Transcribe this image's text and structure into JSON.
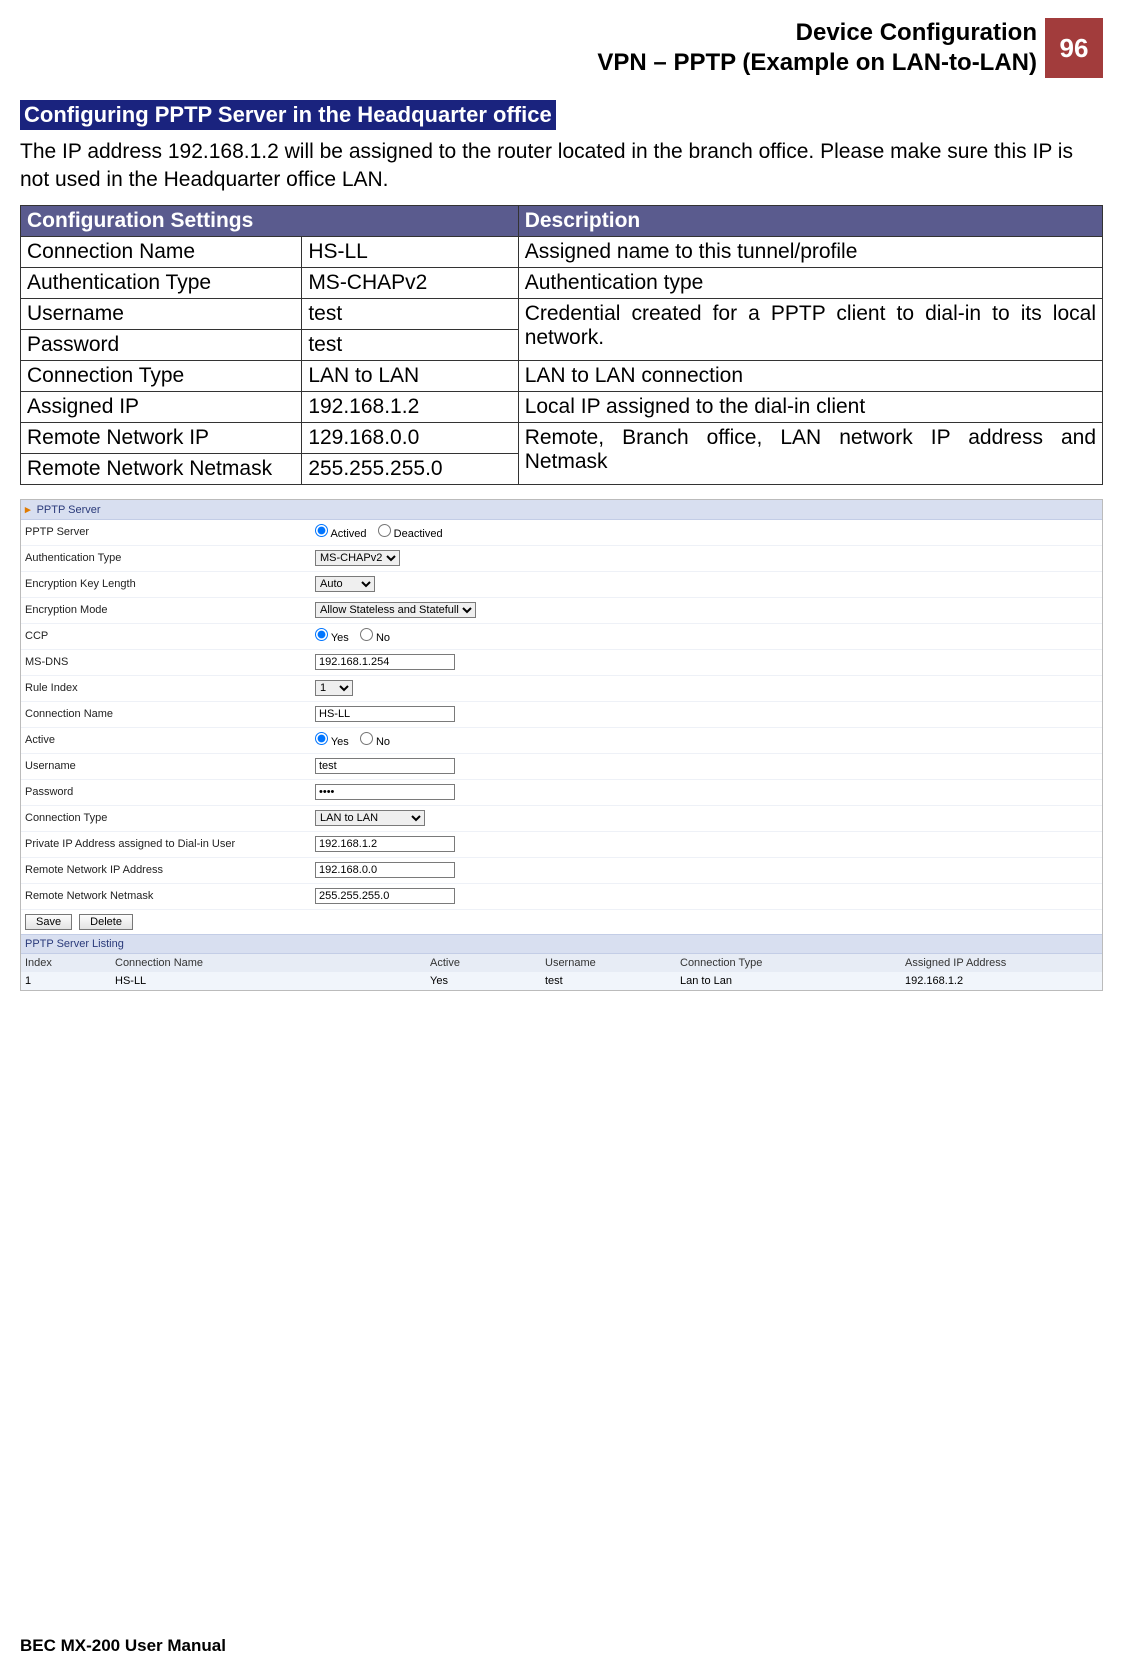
{
  "header": {
    "line1": "Device Configuration",
    "line2": "VPN – PPTP (Example on LAN-to-LAN)",
    "page_number": "96"
  },
  "section": {
    "title": "Configuring PPTP Server in the Headquarter office",
    "paragraph": "The IP address 192.168.1.2 will be assigned to the router located in the branch office. Please make sure this IP is not used in the Headquarter office LAN."
  },
  "cfg_table": {
    "head_settings": "Configuration Settings",
    "head_desc": "Description",
    "rows": {
      "r0": {
        "setting": "Connection Name",
        "value": "HS-LL",
        "desc": "Assigned name to this tunnel/profile"
      },
      "r1": {
        "setting": "Authentication Type",
        "value": "MS-CHAPv2",
        "desc": "Authentication type"
      },
      "r2": {
        "setting": "Username",
        "value": "test"
      },
      "r3": {
        "setting": "Password",
        "value": "test"
      },
      "r23desc": "Credential created for a PPTP client to dial-in to its local network.",
      "r4": {
        "setting": "Connection Type",
        "value": "LAN to LAN",
        "desc": "LAN to LAN connection"
      },
      "r5": {
        "setting": "Assigned IP",
        "value": "192.168.1.2",
        "desc": "Local IP assigned to the dial-in client"
      },
      "r6": {
        "setting": "Remote Network IP",
        "value": "129.168.0.0"
      },
      "r7": {
        "setting": "Remote Network Netmask",
        "value": "255.255.255.0"
      },
      "r67desc": "Remote, Branch office, LAN network IP address and Netmask"
    }
  },
  "router": {
    "panel_title": "PPTP Server",
    "labels": {
      "pptp_server": "PPTP Server",
      "auth_type": "Authentication Type",
      "enc_len": "Encryption Key Length",
      "enc_mode": "Encryption Mode",
      "ccp": "CCP",
      "msdns": "MS-DNS",
      "rule_index": "Rule Index",
      "conn_name": "Connection Name",
      "active": "Active",
      "username": "Username",
      "password": "Password",
      "conn_type": "Connection Type",
      "priv_ip": "Private IP Address assigned to Dial-in User",
      "remote_ip": "Remote Network IP Address",
      "remote_mask": "Remote Network Netmask"
    },
    "radios": {
      "activated": "Actived",
      "deactivated": "Deactived",
      "yes": "Yes",
      "no": "No"
    },
    "selects": {
      "auth_type": "MS-CHAPv2",
      "enc_len": "Auto",
      "enc_mode": "Allow Stateless and Statefull",
      "rule_index": "1",
      "conn_type": "LAN to LAN"
    },
    "inputs": {
      "msdns": "192.168.1.254",
      "conn_name": "HS-LL",
      "username": "test",
      "password": "••••",
      "priv_ip": "192.168.1.2",
      "remote_ip": "192.168.0.0",
      "remote_mask": "255.255.255.0"
    },
    "buttons": {
      "save": "Save",
      "delete": "Delete"
    },
    "listing": {
      "title": "PPTP Server Listing",
      "cols": {
        "index": "Index",
        "conn": "Connection Name",
        "active": "Active",
        "user": "Username",
        "type": "Connection Type",
        "ip": "Assigned IP Address"
      },
      "row": {
        "index": "1",
        "conn": "HS-LL",
        "active": "Yes",
        "user": "test",
        "type": "Lan to Lan",
        "ip": "192.168.1.2"
      }
    }
  },
  "footer": "BEC MX-200 User Manual"
}
